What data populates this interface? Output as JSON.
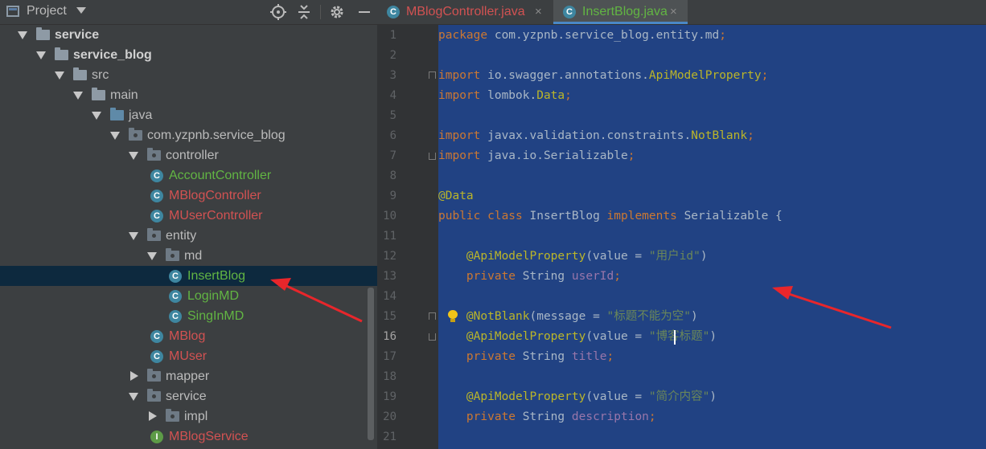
{
  "project_panel": {
    "title": "Project",
    "tree": [
      {
        "label": "service",
        "depth": 0,
        "kind": "module",
        "expanded": true,
        "bold": true
      },
      {
        "label": "service_blog",
        "depth": 1,
        "kind": "module",
        "expanded": true,
        "bold": true
      },
      {
        "label": "src",
        "depth": 2,
        "kind": "folder",
        "expanded": true
      },
      {
        "label": "main",
        "depth": 3,
        "kind": "folder",
        "expanded": true
      },
      {
        "label": "java",
        "depth": 4,
        "kind": "source-folder",
        "expanded": true
      },
      {
        "label": "com.yzpnb.service_blog",
        "depth": 5,
        "kind": "package",
        "expanded": true
      },
      {
        "label": "controller",
        "depth": 6,
        "kind": "package",
        "expanded": true
      },
      {
        "label": "AccountController",
        "depth": 7,
        "kind": "class",
        "color": "green"
      },
      {
        "label": "MBlogController",
        "depth": 7,
        "kind": "class",
        "color": "red"
      },
      {
        "label": "MUserController",
        "depth": 7,
        "kind": "class",
        "color": "red"
      },
      {
        "label": "entity",
        "depth": 6,
        "kind": "package",
        "expanded": true
      },
      {
        "label": "md",
        "depth": 7,
        "kind": "package",
        "expanded": true
      },
      {
        "label": "InsertBlog",
        "depth": 8,
        "kind": "class",
        "color": "green",
        "selected": true
      },
      {
        "label": "LoginMD",
        "depth": 8,
        "kind": "class",
        "color": "green"
      },
      {
        "label": "SingInMD",
        "depth": 8,
        "kind": "class",
        "color": "green"
      },
      {
        "label": "MBlog",
        "depth": 7,
        "kind": "class",
        "color": "red"
      },
      {
        "label": "MUser",
        "depth": 7,
        "kind": "class",
        "color": "red"
      },
      {
        "label": "mapper",
        "depth": 6,
        "kind": "package",
        "expanded": false
      },
      {
        "label": "service",
        "depth": 6,
        "kind": "package",
        "expanded": true
      },
      {
        "label": "impl",
        "depth": 7,
        "kind": "package",
        "expanded": false
      },
      {
        "label": "MBlogService",
        "depth": 7,
        "kind": "interface",
        "color": "red"
      }
    ]
  },
  "tabs": [
    {
      "label": "MBlogController.java",
      "color": "red",
      "active": false
    },
    {
      "label": "InsertBlog.java",
      "color": "green",
      "active": true
    }
  ],
  "icons": {
    "class_letter": "C",
    "interface_letter": "I",
    "close": "×"
  },
  "editor": {
    "current_line": 16,
    "lines": [
      [
        [
          "kw",
          "package "
        ],
        [
          "",
          "com.yzpnb.service_blog.entity.md"
        ],
        [
          "kw",
          ";"
        ]
      ],
      [],
      [
        [
          "kw",
          "import "
        ],
        [
          "",
          "io.swagger.annotations."
        ],
        [
          "an",
          "ApiModelProperty"
        ],
        [
          "kw",
          ";"
        ]
      ],
      [
        [
          "kw",
          "import "
        ],
        [
          "",
          "lombok."
        ],
        [
          "an",
          "Data"
        ],
        [
          "kw",
          ";"
        ]
      ],
      [],
      [
        [
          "kw",
          "import "
        ],
        [
          "",
          "javax.validation.constraints."
        ],
        [
          "an",
          "NotBlank"
        ],
        [
          "kw",
          ";"
        ]
      ],
      [
        [
          "kw",
          "import "
        ],
        [
          "",
          "java.io.Serializable"
        ],
        [
          "kw",
          ";"
        ]
      ],
      [],
      [
        [
          "an",
          "@Data"
        ]
      ],
      [
        [
          "kw",
          "public class "
        ],
        [
          "",
          "InsertBlog "
        ],
        [
          "kw",
          "implements "
        ],
        [
          "",
          "Serializable {"
        ]
      ],
      [],
      [
        [
          "",
          "    "
        ],
        [
          "an",
          "@ApiModelProperty"
        ],
        [
          "",
          "(value = "
        ],
        [
          "st",
          "\"用户id\""
        ],
        [
          "",
          ")"
        ]
      ],
      [
        [
          "",
          "    "
        ],
        [
          "kw",
          "private "
        ],
        [
          "",
          "String "
        ],
        [
          "fl",
          "userId"
        ],
        [
          "kw",
          ";"
        ]
      ],
      [],
      [
        [
          "",
          "    "
        ],
        [
          "an",
          "@NotBlank"
        ],
        [
          "",
          "(message = "
        ],
        [
          "st",
          "\"标题不能为空\""
        ],
        [
          "",
          ")"
        ]
      ],
      [
        [
          "",
          "    "
        ],
        [
          "an",
          "@ApiModelProperty"
        ],
        [
          "",
          "(value = "
        ],
        [
          "st",
          "\"博客标题\""
        ],
        [
          "",
          ")"
        ]
      ],
      [
        [
          "",
          "    "
        ],
        [
          "kw",
          "private "
        ],
        [
          "",
          "String "
        ],
        [
          "fl",
          "title"
        ],
        [
          "kw",
          ";"
        ]
      ],
      [],
      [
        [
          "",
          "    "
        ],
        [
          "an",
          "@ApiModelProperty"
        ],
        [
          "",
          "(value = "
        ],
        [
          "st",
          "\"简介内容\""
        ],
        [
          "",
          ")"
        ]
      ],
      [
        [
          "",
          "    "
        ],
        [
          "kw",
          "private "
        ],
        [
          "",
          "String "
        ],
        [
          "fl",
          "description"
        ],
        [
          "kw",
          ";"
        ]
      ],
      []
    ]
  },
  "colors": {
    "selection": "#214283",
    "annotation_arrow": "#e8262b"
  }
}
